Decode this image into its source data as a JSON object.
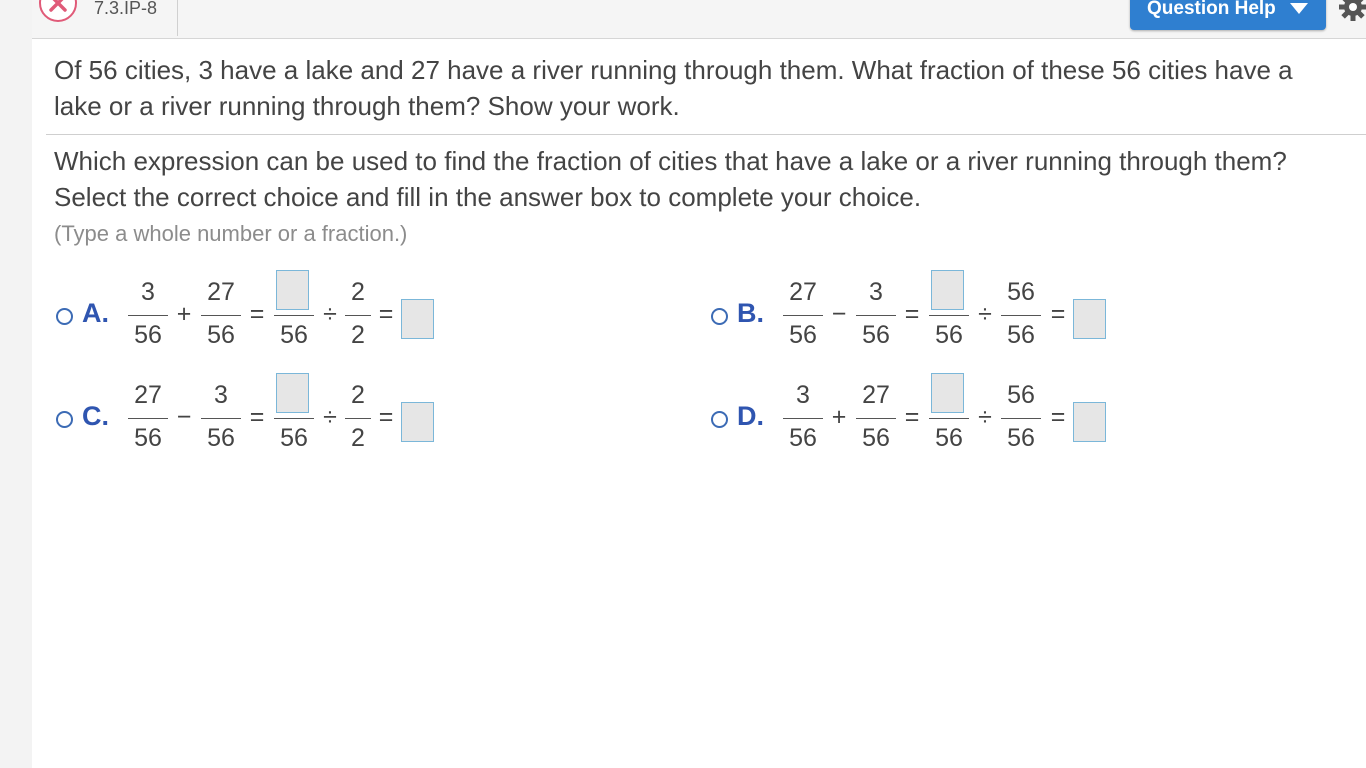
{
  "header": {
    "question_id": "7.3.IP-8",
    "help_label": "Question Help"
  },
  "question": {
    "text": "Of 56 cities, 3 have a lake and 27 have a river running through them. What fraction of these 56 cities have a lake or a river running through them? Show your work."
  },
  "instruction": {
    "text": "Which expression can be used to find the fraction of cities that have a lake or a river running through them? Select the correct choice and fill in the answer box to complete your choice.",
    "hint": "(Type a whole number or a fraction.)"
  },
  "choices": [
    {
      "letter": "A.",
      "f1_num": "3",
      "f1_den": "56",
      "op1": "+",
      "f2_num": "27",
      "f2_den": "56",
      "eq": "=",
      "f3_den": "56",
      "div": "÷",
      "f4_num": "2",
      "f4_den": "2",
      "eq2": "="
    },
    {
      "letter": "B.",
      "f1_num": "27",
      "f1_den": "56",
      "op1": "−",
      "f2_num": "3",
      "f2_den": "56",
      "eq": "=",
      "f3_den": "56",
      "div": "÷",
      "f4_num": "56",
      "f4_den": "56",
      "eq2": "="
    },
    {
      "letter": "C.",
      "f1_num": "27",
      "f1_den": "56",
      "op1": "−",
      "f2_num": "3",
      "f2_den": "56",
      "eq": "=",
      "f3_den": "56",
      "div": "÷",
      "f4_num": "2",
      "f4_den": "2",
      "eq2": "="
    },
    {
      "letter": "D.",
      "f1_num": "3",
      "f1_den": "56",
      "op1": "+",
      "f2_num": "27",
      "f2_den": "56",
      "eq": "=",
      "f3_den": "56",
      "div": "÷",
      "f4_num": "56",
      "f4_den": "56",
      "eq2": "="
    }
  ],
  "colors": {
    "accent": "#2f7fd0",
    "choice_letter": "#2f55b0",
    "close_icon": "#e05a78",
    "answer_box_border": "#7bb7d9"
  },
  "icons": [
    "close-icon",
    "caret-down-icon",
    "gear-icon"
  ]
}
